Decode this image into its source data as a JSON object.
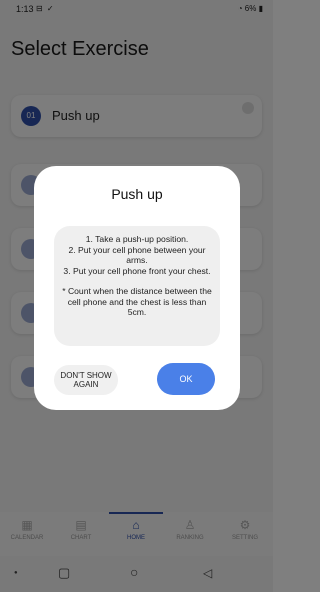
{
  "status_bar": {
    "time": "1:13",
    "left_icons": "⊟ ✓",
    "right": "6%"
  },
  "page_title": "Select Exercise",
  "exercises": [
    {
      "num": "01",
      "label": "Push up"
    }
  ],
  "bottom_nav": [
    {
      "label": "CALENDAR",
      "icon": "calendar-icon"
    },
    {
      "label": "CHART",
      "icon": "chart-icon"
    },
    {
      "label": "HOME",
      "icon": "home-icon",
      "active": true
    },
    {
      "label": "RANKING",
      "icon": "ranking-icon"
    },
    {
      "label": "SETTING",
      "icon": "setting-icon"
    }
  ],
  "dialog": {
    "title": "Push up",
    "instructions": [
      "1. Take a push-up position.",
      "2. Put your cell phone between your arms.",
      "3. Put your cell phone front your chest."
    ],
    "note": "* Count when the distance between the cell phone and the chest is less than 5cm.",
    "dont_show_label": "DON'T SHOW AGAIN",
    "ok_label": "OK"
  },
  "colors": {
    "accent": "#2e4fa8",
    "ok_button": "#4a80e8",
    "scrim": "rgba(0,0,0,0.5)"
  }
}
